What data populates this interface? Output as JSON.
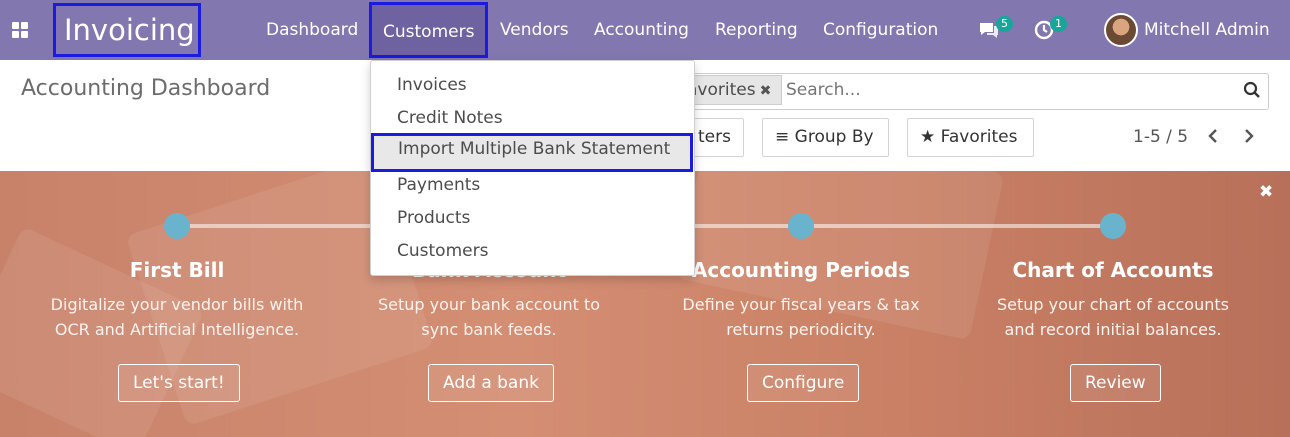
{
  "navbar": {
    "brand": "Invoicing",
    "menu": [
      "Dashboard",
      "Customers",
      "Vendors",
      "Accounting",
      "Reporting",
      "Configuration"
    ],
    "messages_count": "5",
    "activities_count": "1",
    "user_name": "Mitchell Admin"
  },
  "control_panel": {
    "title": "Accounting Dashboard",
    "facet_label": "avorites",
    "search_placeholder": "Search...",
    "filters_label": "ters",
    "group_by_label": "Group By",
    "favorites_label": "Favorites",
    "pager": "1-5 / 5"
  },
  "dropdown": {
    "items": [
      "Invoices",
      "Credit Notes",
      "Import Multiple Bank Statement",
      "Payments",
      "Products",
      "Customers"
    ]
  },
  "banner": {
    "steps": [
      {
        "title": "First Bill",
        "desc1": "Digitalize your vendor bills with",
        "desc2": "OCR and Artificial Intelligence.",
        "button": "Let's start!"
      },
      {
        "title": "Bank Account",
        "desc1": "Setup your bank account to",
        "desc2": "sync bank feeds.",
        "button": "Add a bank"
      },
      {
        "title": "Accounting Periods",
        "desc1": "Define your fiscal years & tax",
        "desc2": "returns periodicity.",
        "button": "Configure"
      },
      {
        "title": "Chart of Accounts",
        "desc1": "Setup your chart of accounts",
        "desc2": "and record initial balances.",
        "button": "Review"
      }
    ]
  },
  "colors": {
    "navbar": "#8377b0",
    "highlight_border": "#1a1ae0",
    "banner": "#d48e73",
    "step_dot": "#6ab3cc",
    "badge": "#1aa59a"
  },
  "icons": [
    "apps-icon",
    "chat-icon",
    "clock-icon",
    "search-icon",
    "close-icon",
    "list-icon",
    "star-icon",
    "chevron-left-icon",
    "chevron-right-icon"
  ]
}
